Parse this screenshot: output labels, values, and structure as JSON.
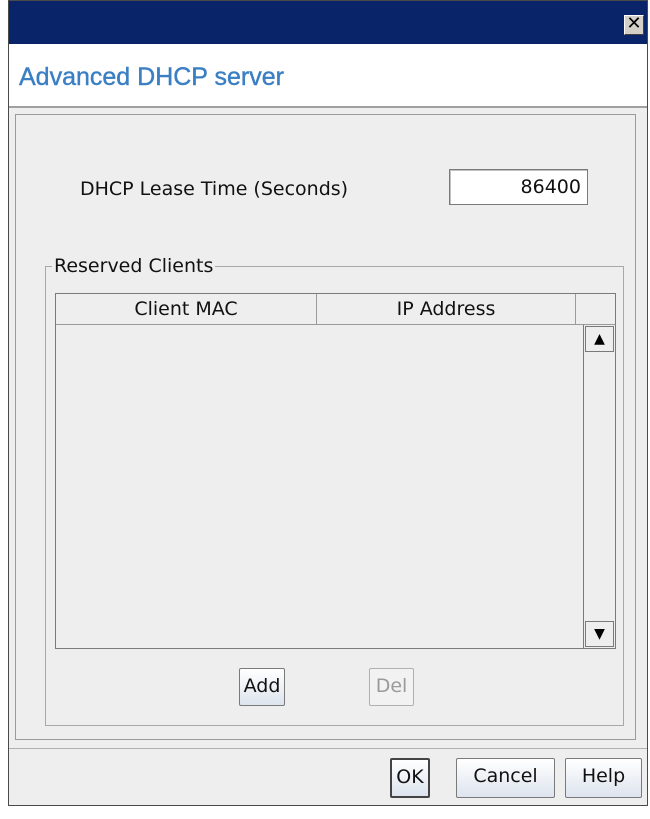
{
  "window": {
    "close_glyph": "✕"
  },
  "header": {
    "title": "Advanced DHCP server"
  },
  "lease": {
    "label": "DHCP Lease Time (Seconds)",
    "value": "86400"
  },
  "reserved_clients": {
    "group_title": "Reserved Clients",
    "columns": [
      "Client MAC",
      "IP Address"
    ],
    "rows": [],
    "scroll_up_glyph": "▲",
    "scroll_down_glyph": "▼",
    "add_label": "Add",
    "del_label": "Del"
  },
  "footer": {
    "ok_label": "OK",
    "cancel_label": "Cancel",
    "help_label": "Help"
  }
}
